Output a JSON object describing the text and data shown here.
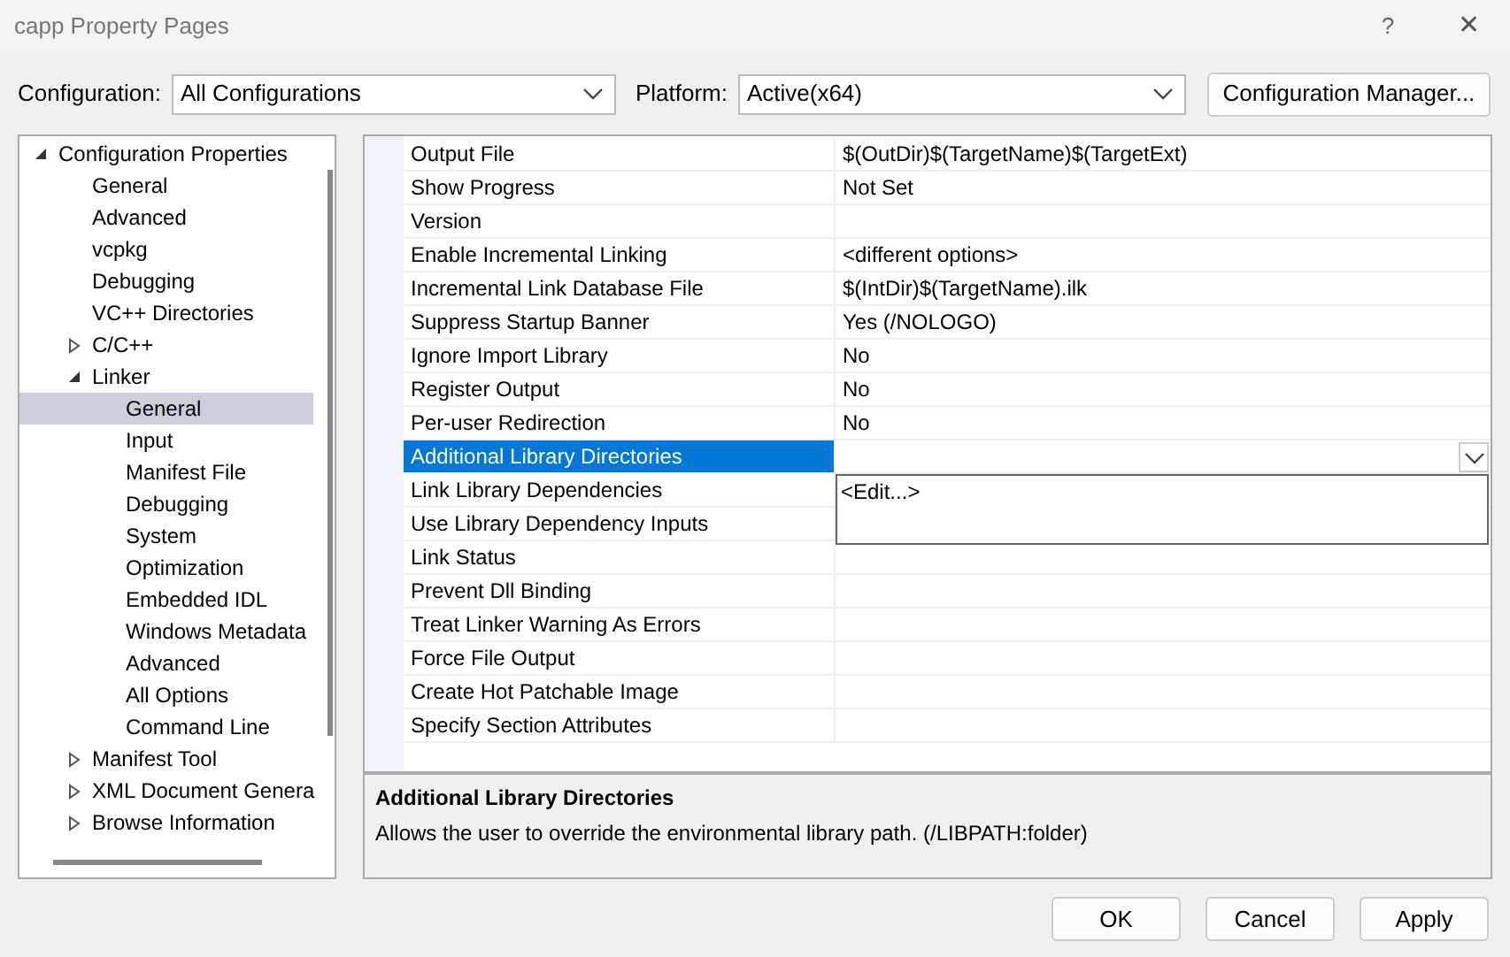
{
  "window": {
    "title": "capp Property Pages",
    "help": "?",
    "close": "✕"
  },
  "toolbar": {
    "configuration": {
      "label": "Configuration:",
      "value": "All Configurations"
    },
    "platform": {
      "label": "Platform:",
      "value": "Active(x64)"
    },
    "manager_button": "Configuration Manager..."
  },
  "tree": [
    {
      "label": "Configuration Properties",
      "expanded": true,
      "selected": false,
      "children": [
        {
          "label": "General",
          "selected": false
        },
        {
          "label": "Advanced",
          "selected": false
        },
        {
          "label": "vcpkg",
          "selected": false
        },
        {
          "label": "Debugging",
          "selected": false
        },
        {
          "label": "VC++ Directories",
          "selected": false
        },
        {
          "label": "C/C++",
          "expanded": false,
          "selected": false
        },
        {
          "label": "Linker",
          "expanded": true,
          "selected": false,
          "children": [
            {
              "label": "General",
              "selected": true
            },
            {
              "label": "Input",
              "selected": false
            },
            {
              "label": "Manifest File",
              "selected": false
            },
            {
              "label": "Debugging",
              "selected": false
            },
            {
              "label": "System",
              "selected": false
            },
            {
              "label": "Optimization",
              "selected": false
            },
            {
              "label": "Embedded IDL",
              "selected": false
            },
            {
              "label": "Windows Metadata",
              "selected": false
            },
            {
              "label": "Advanced",
              "selected": false
            },
            {
              "label": "All Options",
              "selected": false
            },
            {
              "label": "Command Line",
              "selected": false
            }
          ]
        },
        {
          "label": "Manifest Tool",
          "expanded": false,
          "selected": false
        },
        {
          "label": "XML Document Genera",
          "expanded": false,
          "selected": false
        },
        {
          "label": "Browse Information",
          "expanded": false,
          "selected": false
        }
      ]
    }
  ],
  "properties": [
    {
      "label": "Output File",
      "value": "$(OutDir)$(TargetName)$(TargetExt)",
      "selected": false
    },
    {
      "label": "Show Progress",
      "value": "Not Set",
      "selected": false
    },
    {
      "label": "Version",
      "selected": false
    },
    {
      "label": "Enable Incremental Linking",
      "value": "<different options>",
      "selected": false
    },
    {
      "label": "Incremental Link Database File",
      "value": "$(IntDir)$(TargetName).ilk",
      "selected": false
    },
    {
      "label": "Suppress Startup Banner",
      "value": "Yes (/NOLOGO)",
      "selected": false
    },
    {
      "label": "Ignore Import Library",
      "value": "No",
      "selected": false
    },
    {
      "label": "Register Output",
      "value": "No",
      "selected": false
    },
    {
      "label": "Per-user Redirection",
      "value": "No",
      "selected": false
    },
    {
      "label": "Additional Library Directories",
      "selected": true,
      "dropdown": {
        "options": [
          "<Edit...>"
        ]
      }
    },
    {
      "label": "Link Library Dependencies",
      "selected": false
    },
    {
      "label": "Use Library Dependency Inputs",
      "selected": false
    },
    {
      "label": "Link Status",
      "selected": false
    },
    {
      "label": "Prevent Dll Binding",
      "selected": false
    },
    {
      "label": "Treat Linker Warning As Errors",
      "selected": false
    },
    {
      "label": "Force File Output",
      "selected": false
    },
    {
      "label": "Create Hot Patchable Image",
      "selected": false
    },
    {
      "label": "Specify Section Attributes",
      "selected": false
    }
  ],
  "description": {
    "title": "Additional Library Directories",
    "text": "Allows the user to override the environmental library path. (/LIBPATH:folder)"
  },
  "buttons": [
    "OK",
    "Cancel",
    "Apply"
  ]
}
